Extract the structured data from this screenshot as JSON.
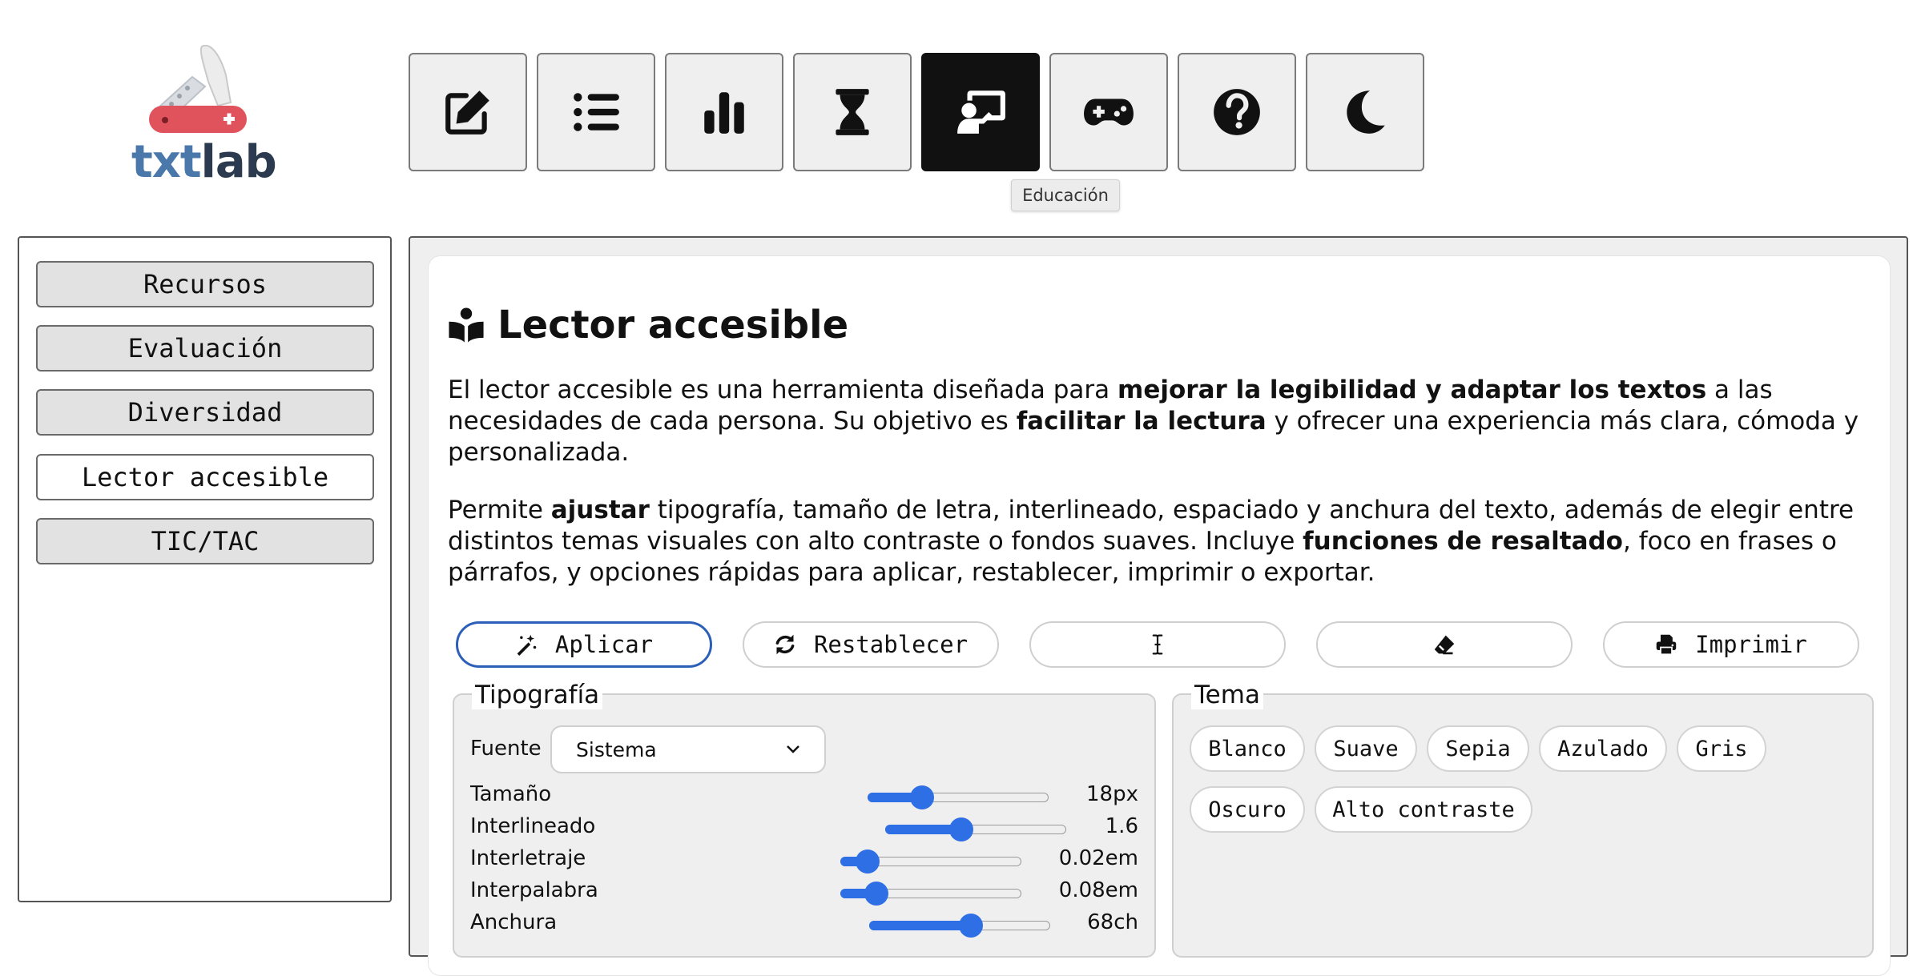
{
  "logo": {
    "text_a": "txt",
    "text_b": "lab"
  },
  "toolbar": {
    "items": [
      {
        "name": "edit",
        "icon": "edit-icon"
      },
      {
        "name": "list",
        "icon": "list-icon"
      },
      {
        "name": "stats",
        "icon": "bar-chart-icon"
      },
      {
        "name": "timer",
        "icon": "hourglass-icon"
      },
      {
        "name": "education",
        "icon": "chalkboard-teacher-icon",
        "active": true
      },
      {
        "name": "games",
        "icon": "gamepad-icon"
      },
      {
        "name": "help",
        "icon": "question-circle-icon"
      },
      {
        "name": "dark-mode",
        "icon": "moon-icon"
      }
    ],
    "tooltip": "Educación"
  },
  "sidebar": {
    "items": [
      {
        "label": "Recursos"
      },
      {
        "label": "Evaluación"
      },
      {
        "label": "Diversidad"
      },
      {
        "label": "Lector accesible",
        "active": true
      },
      {
        "label": "TIC/TAC"
      }
    ]
  },
  "main": {
    "title": "Lector accesible",
    "p1": {
      "t1": "El lector accesible es una herramienta diseñada para ",
      "b1": "mejorar la legibilidad y adaptar los textos",
      "t2": " a las necesidades de cada persona. Su objetivo es ",
      "b2": "facilitar la lectura",
      "t3": " y ofrecer una experiencia más clara, cómoda y personalizada."
    },
    "p2": {
      "t1": "Permite ",
      "b1": "ajustar",
      "t2": " tipografía, tamaño de letra, interlineado, espaciado y anchura del texto, además de elegir entre distintos temas visuales con alto contraste o fondos suaves. Incluye ",
      "b2": "funciones de resaltado",
      "t3": ", foco en frases o párrafos, y opciones rápidas para aplicar, restablecer, imprimir o exportar."
    },
    "actions": {
      "apply": "Aplicar",
      "reset": "Restablecer",
      "print": "Imprimir"
    },
    "typography": {
      "legend": "Tipografía",
      "font_label": "Fuente",
      "font_value": "Sistema",
      "sliders": [
        {
          "label": "Tamaño",
          "value": "18px",
          "fraction": 0.3
        },
        {
          "label": "Interlineado",
          "value": "1.6",
          "fraction": 0.42
        },
        {
          "label": "Interletraje",
          "value": "0.02em",
          "fraction": 0.15
        },
        {
          "label": "Interpalabra",
          "value": "0.08em",
          "fraction": 0.2
        },
        {
          "label": "Anchura",
          "value": "68ch",
          "fraction": 0.56
        }
      ]
    },
    "theme": {
      "legend": "Tema",
      "options": [
        "Blanco",
        "Suave",
        "Sepia",
        "Azulado",
        "Gris",
        "Oscuro",
        "Alto contraste"
      ]
    }
  },
  "colors": {
    "accent": "#2f6fe6",
    "active_tool": "#111111",
    "logo_blue": "#4a78ab",
    "logo_dark": "#2b3a4f",
    "logo_red": "#e0525c"
  }
}
